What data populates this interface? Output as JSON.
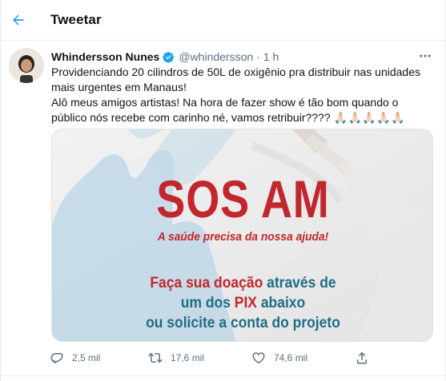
{
  "header": {
    "title": "Tweetar",
    "back_icon": "arrow-left-icon"
  },
  "tweet": {
    "author_name": "Whindersson Nunes",
    "handle": "@whindersson",
    "separator": "·",
    "time": "1 h",
    "verified": true,
    "text_line1": "Providenciando 20 cilindros de 50L de oxigênio pra distribuir nas unidades mais urgentes em Manaus!",
    "text_line2": "Alô meus amigos artistas! Na hora de fazer show é tão bom quando o público nós recebe com carinho né, vamos retribuir????",
    "text_emoji": "🙏🏻🙏🏻🙏🏻🙏🏻🙏🏻"
  },
  "media": {
    "title": "SOS AM",
    "subtitle": "A saúde precisa da nossa ajuda!",
    "line1_red": "Faça sua doação",
    "line1_teal": " através de",
    "line2_teal_a": "um dos ",
    "line2_red": "PIX",
    "line2_teal_b": " abaixo",
    "line3_teal": "ou solicite a conta do projeto"
  },
  "actions": {
    "replies": "2,5 mil",
    "retweets": "17,6 mil",
    "likes": "74,6 mil"
  },
  "colors": {
    "accent": "#1da1f2",
    "text": "#0f1419",
    "muted": "#5b7083",
    "sos_red": "#c1272d",
    "sos_teal": "#1f6d86"
  }
}
